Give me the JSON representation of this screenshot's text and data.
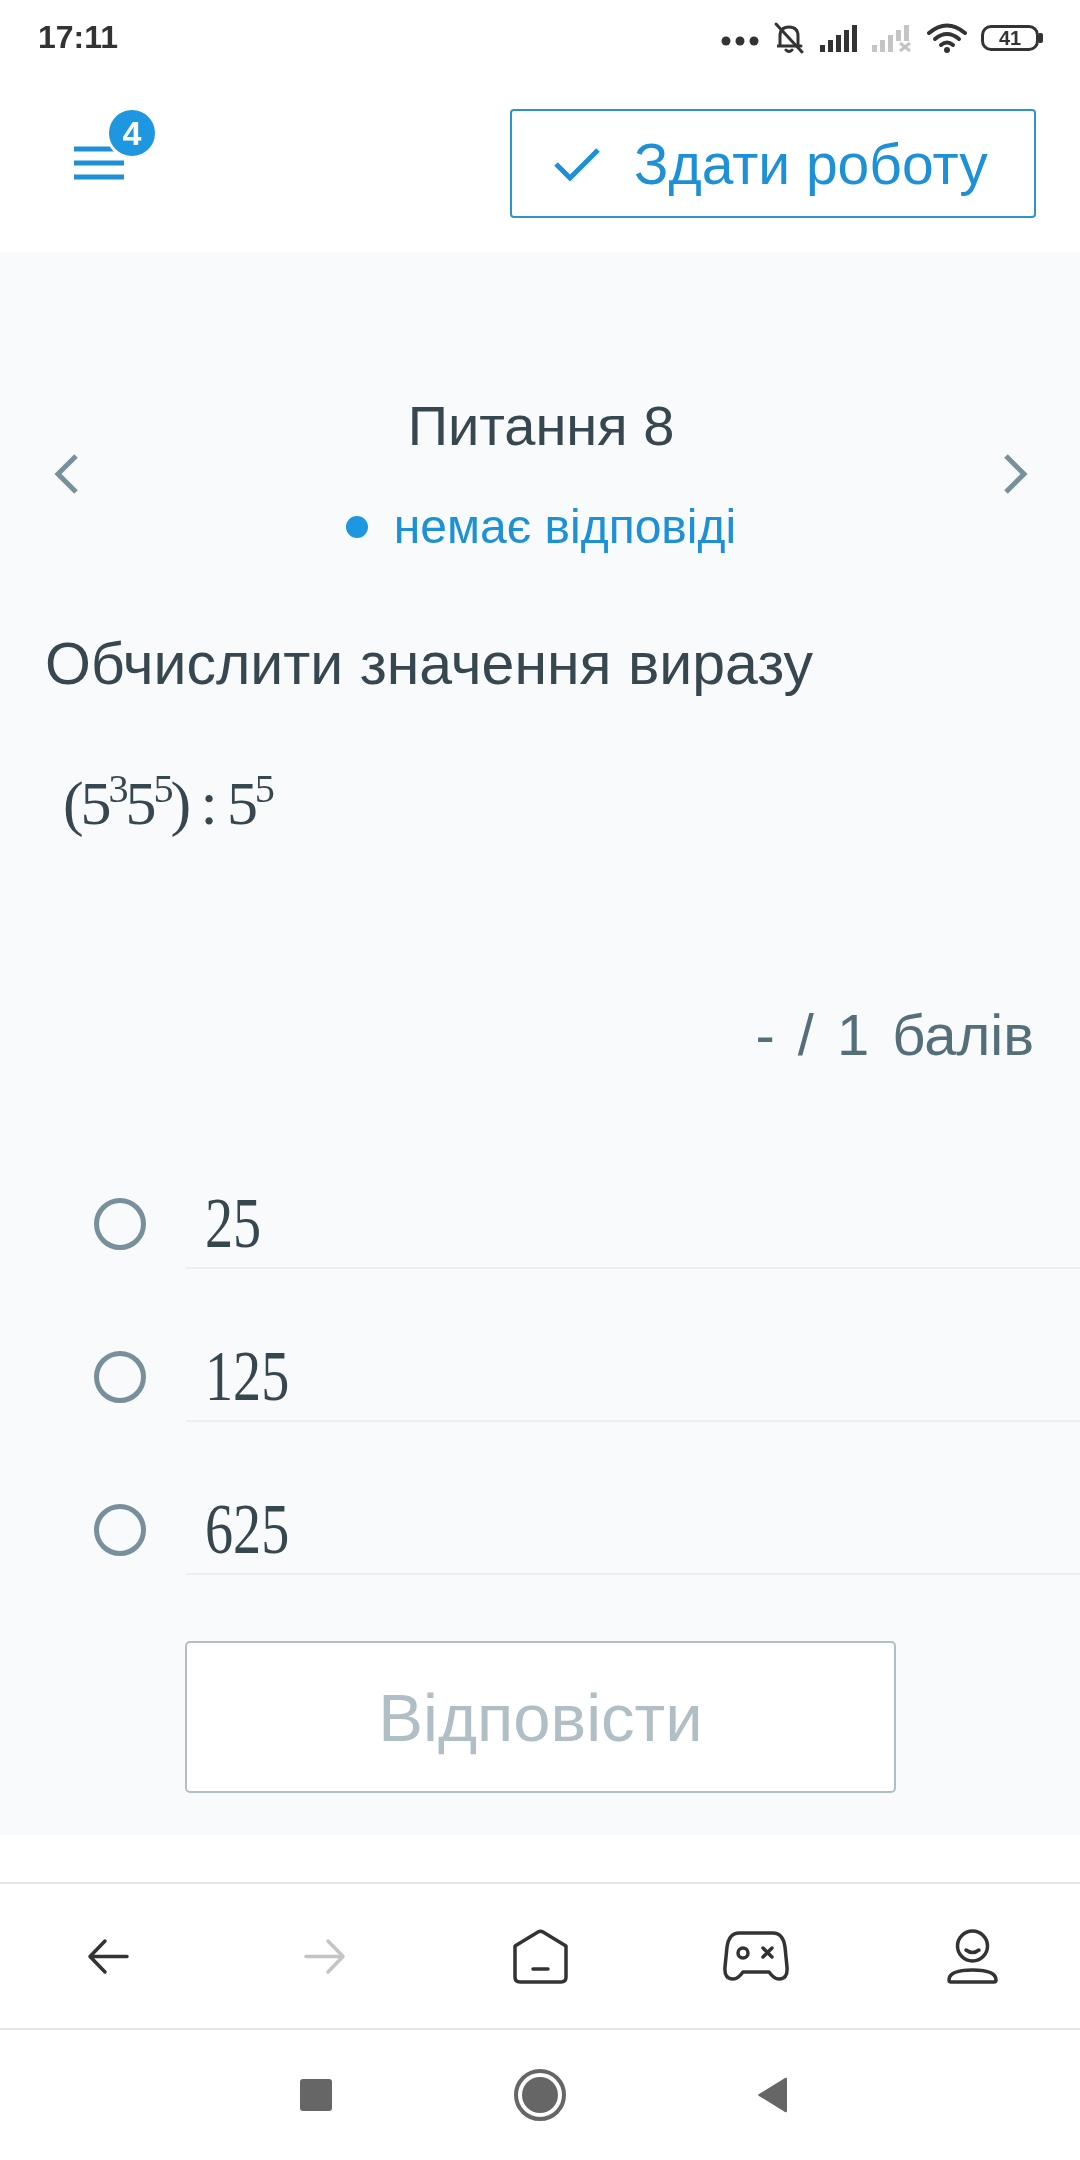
{
  "status_bar": {
    "time": "17:11",
    "battery": "41"
  },
  "header": {
    "menu_badge": "4",
    "submit_button": "Здати роботу"
  },
  "question": {
    "title": "Питання 8",
    "status": "немає відповіді",
    "prompt": "Обчислити значення виразу",
    "expression": "(5$^{3}$5$^{5}$) : 5$^{5}$",
    "points": "- / 1 балів"
  },
  "options": [
    {
      "label": "25",
      "selected": false
    },
    {
      "label": "125",
      "selected": false
    },
    {
      "label": "625",
      "selected": false
    }
  ],
  "answer_button": {
    "label": "Відповісти",
    "disabled": true
  },
  "browser_toolbar": {
    "items": [
      {
        "kind": "back",
        "disabled": false
      },
      {
        "kind": "forward",
        "disabled": true
      },
      {
        "kind": "home",
        "disabled": false
      },
      {
        "kind": "games",
        "disabled": false
      },
      {
        "kind": "profile",
        "disabled": false
      }
    ]
  }
}
